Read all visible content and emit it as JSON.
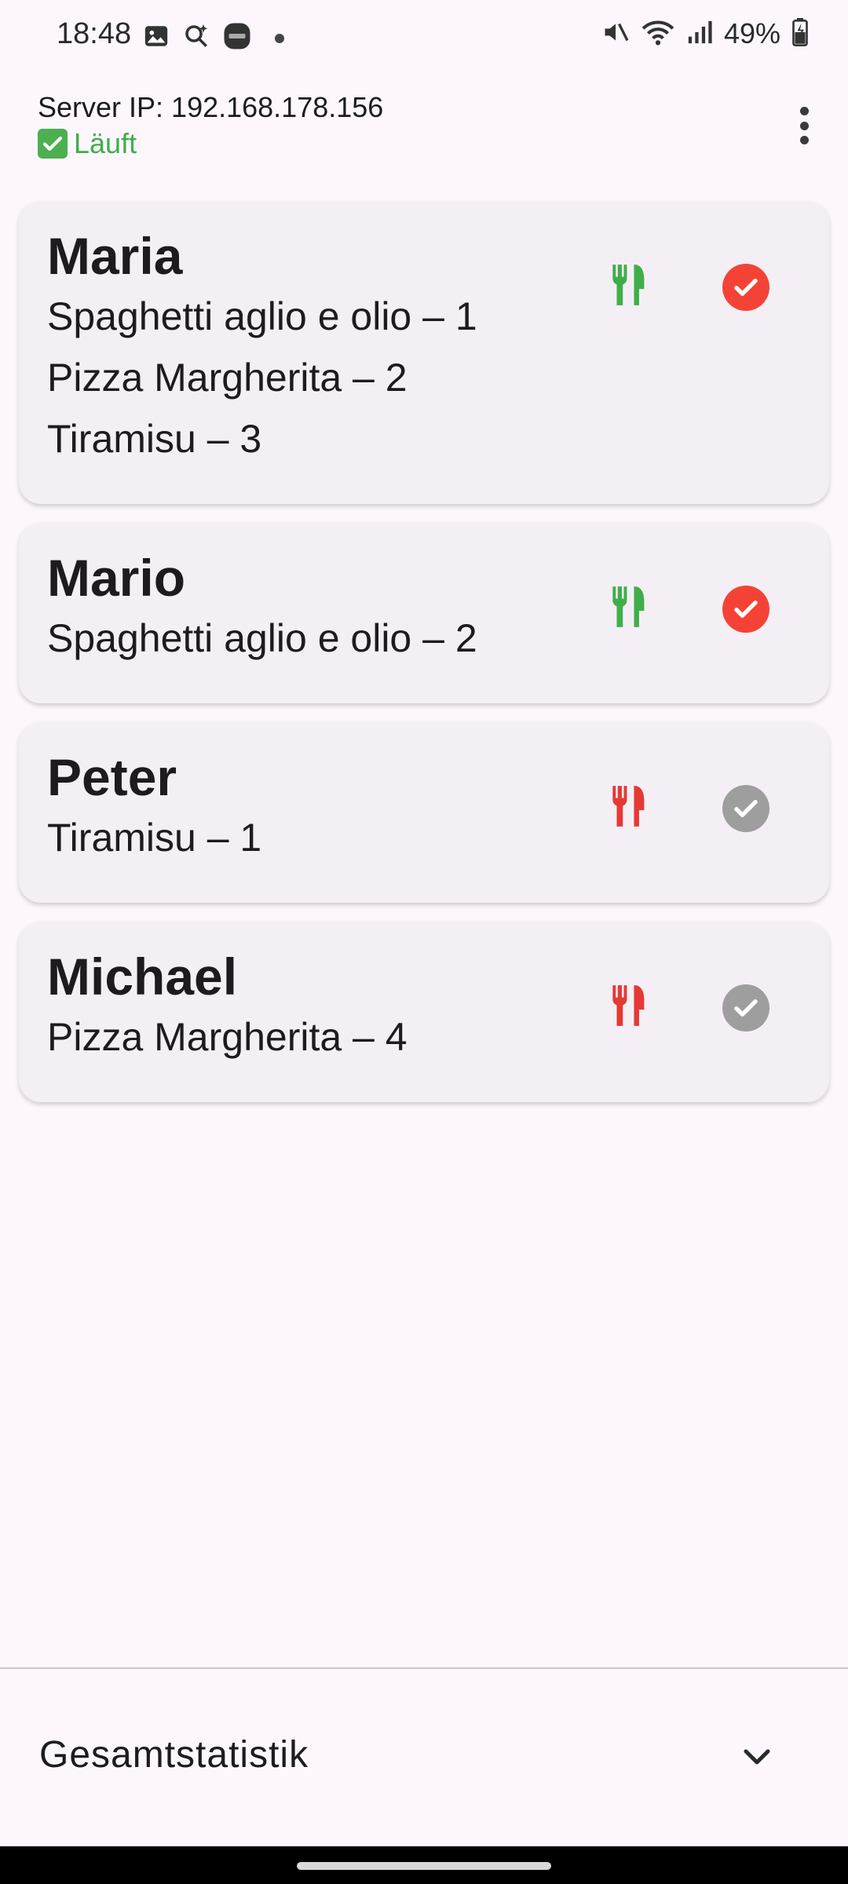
{
  "status_bar": {
    "time": "18:48",
    "battery": "49%",
    "left_icons": [
      "gallery-icon",
      "search-sparkle-icon",
      "news-app-icon",
      "notification-dot-icon"
    ],
    "right_icons": [
      "mute-icon",
      "wifi-icon",
      "signal-icon",
      "battery-icon"
    ]
  },
  "header": {
    "server_ip": "Server IP: 192.168.178.156",
    "status": "Läuft",
    "status_color": "#3fae49"
  },
  "orders": [
    {
      "name": "Maria",
      "items": [
        "Spaghetti aglio e olio – 1",
        "Pizza Margherita – 2",
        "Tiramisu – 3"
      ],
      "served": true,
      "done": true
    },
    {
      "name": "Mario",
      "items": [
        "Spaghetti aglio e olio – 2"
      ],
      "served": true,
      "done": true
    },
    {
      "name": "Peter",
      "items": [
        "Tiramisu – 1"
      ],
      "served": false,
      "done": false
    },
    {
      "name": "Michael",
      "items": [
        "Pizza Margherita – 4"
      ],
      "served": false,
      "done": false
    }
  ],
  "colors": {
    "served": "#3fae49",
    "not_served": "#e53935",
    "done": "#f44336",
    "not_done": "#9e9e9e"
  },
  "footer": {
    "stats_label": "Gesamtstatistik"
  }
}
